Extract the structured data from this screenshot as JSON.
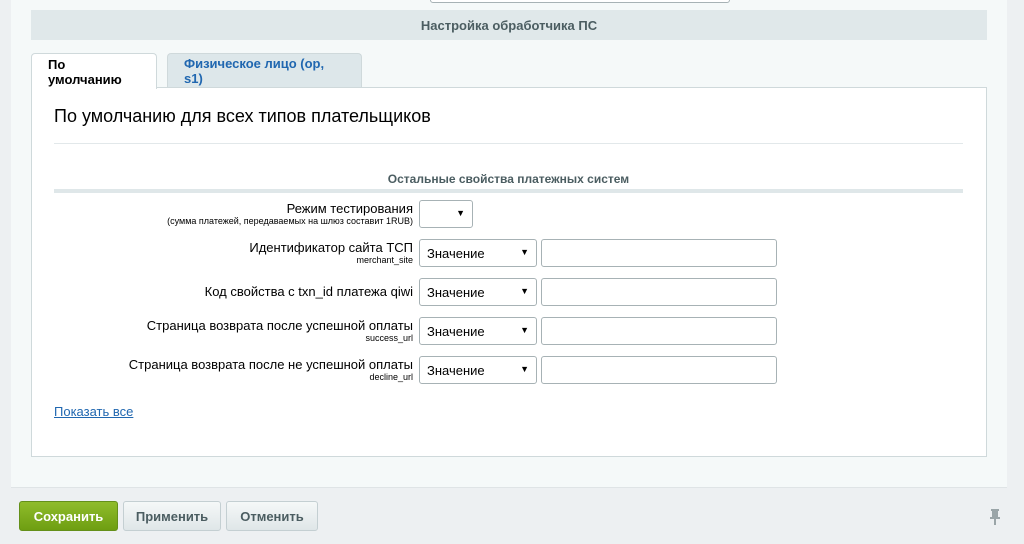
{
  "header": {
    "title": "Настройка обработчика ПС"
  },
  "tabs": [
    {
      "label": "По умолчанию",
      "active": true
    },
    {
      "label": "Физическое лицо (op, s1)",
      "active": false
    }
  ],
  "content": {
    "title": "По умолчанию для всех типов плательщиков",
    "section_heading": "Остальные свойства платежных систем",
    "rows": [
      {
        "label": "Режим тестирования",
        "sublabel": "(сумма платежей, передаваемых на шлюз составит 1RUB)",
        "select_value": "",
        "input_value": ""
      },
      {
        "label": "Идентификатор сайта ТСП",
        "sublabel": "merchant_site",
        "select_value": "Значение",
        "input_value": ""
      },
      {
        "label": "Код свойства с txn_id платежа qiwi",
        "sublabel": "",
        "select_value": "Значение",
        "input_value": ""
      },
      {
        "label": "Страница возврата после успешной оплаты",
        "sublabel": "success_url",
        "select_value": "Значение",
        "input_value": ""
      },
      {
        "label": "Страница возврата после не успешной оплаты",
        "sublabel": "decline_url",
        "select_value": "Значение",
        "input_value": ""
      }
    ],
    "show_all_link": "Показать все"
  },
  "footer": {
    "save_label": "Сохранить",
    "apply_label": "Применить",
    "cancel_label": "Отменить"
  },
  "icons": {
    "dropdown": "chevron-down-icon",
    "pin": "pin-icon"
  },
  "colors": {
    "save_button": "#7aac1c",
    "link": "#2067b0",
    "header_bg": "#e0e8ea"
  }
}
